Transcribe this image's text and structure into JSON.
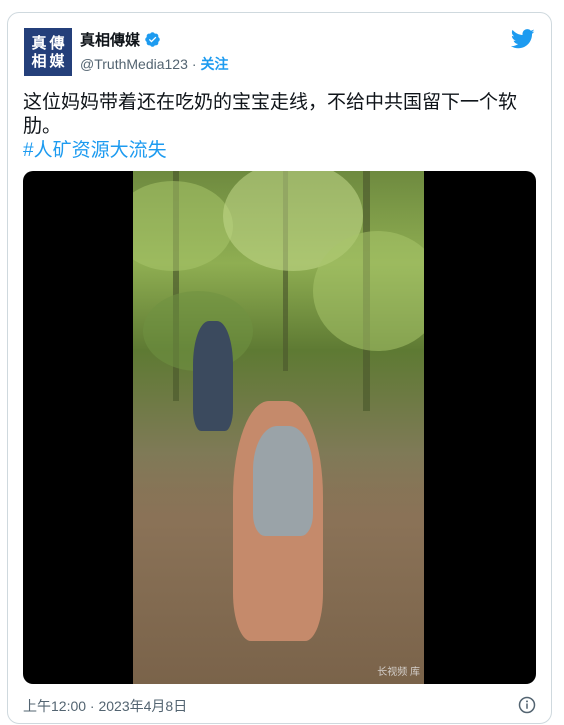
{
  "tweet": {
    "author": {
      "display_name": "真相傳媒",
      "handle": "@TruthMedia123",
      "avatar_chars": [
        "真",
        "傳",
        "相",
        "媒"
      ],
      "verified": true
    },
    "separator": "·",
    "follow_label": "关注",
    "text": "这位妈妈带着还在吃奶的宝宝走线，不给中共国留下一个软肋。",
    "hashtag": "#人矿资源大流失",
    "media": {
      "type": "video",
      "watermark": "长视频 库"
    },
    "timestamp": "上午12:00 · 2023年4月8日"
  },
  "icons": {
    "verified": "verified-badge-icon",
    "brand": "twitter-bird-icon",
    "info": "info-icon"
  },
  "colors": {
    "accent": "#1d9bf0",
    "text": "#0f1419",
    "secondary": "#536471",
    "border": "#cfd9de",
    "avatar_bg": "#243f7a"
  }
}
